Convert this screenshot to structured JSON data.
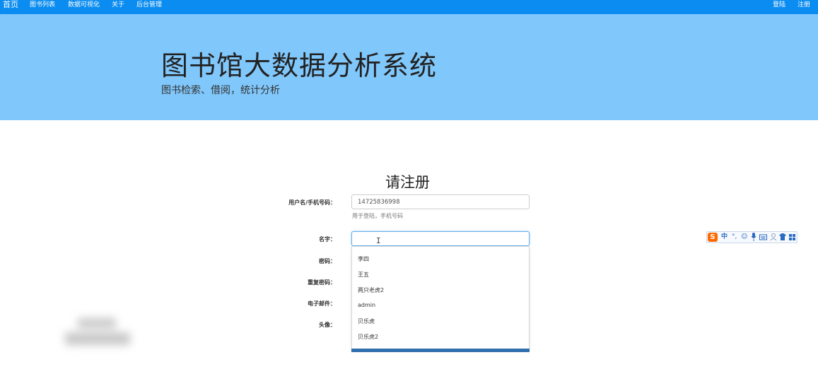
{
  "nav": {
    "brand": "首页",
    "items": [
      "图书列表",
      "数据可视化",
      "关于",
      "后台管理"
    ],
    "login": "登陆",
    "register": "注册"
  },
  "hero": {
    "title": "图书馆大数据分析系统",
    "subtitle": "图书检索、借阅，统计分析"
  },
  "form": {
    "title": "请注册",
    "username": {
      "label": "用户名/手机号码：",
      "value": "14725836998",
      "help": "用于登陆，手机号码"
    },
    "name": {
      "label": "名字：",
      "value": ""
    },
    "password": {
      "label": "密码："
    },
    "confirm_password": {
      "label": "重复密码："
    },
    "email": {
      "label": "电子邮件："
    },
    "avatar": {
      "label": "头像："
    }
  },
  "autocomplete": {
    "options": [
      "李四",
      "王五",
      "两只老虎2",
      "admin",
      "贝乐虎",
      "贝乐虎2"
    ]
  },
  "ime_toolbar": {
    "logo": "S",
    "items": [
      "中",
      "°,",
      "☺",
      "mic",
      "keyboard",
      "person",
      "shirt",
      "grid"
    ]
  },
  "colors": {
    "navbar": "#0a8cf0",
    "hero": "#80c7fb",
    "submit": "#2f6fad"
  }
}
